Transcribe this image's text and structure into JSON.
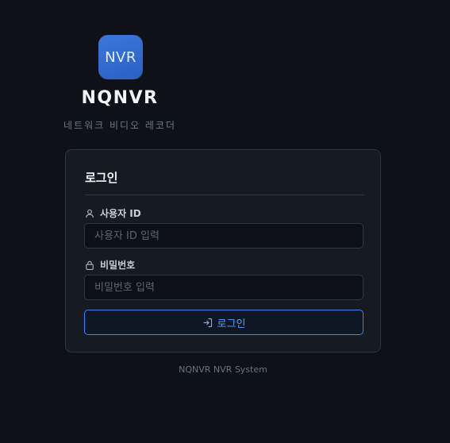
{
  "brand": {
    "logo_text": "NVR",
    "app_name": "NQNVR",
    "subtitle": "네트워크 비디오 레코더"
  },
  "login_card": {
    "title": "로그인",
    "user_id": {
      "label": "사용자 ID",
      "icon": "user-icon",
      "placeholder": "사용자 ID 입력",
      "value": ""
    },
    "password": {
      "label": "비밀번호",
      "icon": "lock-icon",
      "placeholder": "비밀번호 입력",
      "value": ""
    },
    "submit": {
      "label": "로그인",
      "icon": "sign-in-icon"
    }
  },
  "footer": {
    "text": "NQNVR NVR System"
  },
  "colors": {
    "background": "#0e1218",
    "card": "#161b22",
    "accent": "#3b82f6",
    "logo_tile": "#2f68d0"
  }
}
